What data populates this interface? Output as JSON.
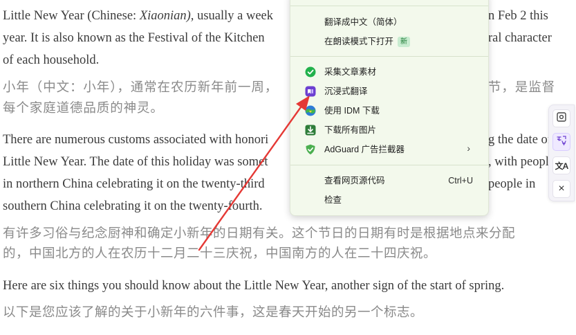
{
  "article": {
    "p1": [
      "Little New Year (Chinese: ",
      "Xiaonian),",
      " usually a week",
      "n Feb 2 this",
      "year. It is also known as the Festival of the Kitchen",
      "ral character",
      "of each household."
    ],
    "zh1": [
      "小年（中文：小年），通常在农历新年前一周，",
      "节，是监督",
      "每个家庭道德品质的神灵。"
    ],
    "p2": [
      "There are numerous customs associated with honori",
      "g the date of",
      "Little New Year. The date of this holiday was somet",
      ", with peopl",
      "in northern China celebrating it on the twenty-third",
      "people in",
      "southern China celebrating it on the twenty-fourth."
    ],
    "zh2": [
      "有许多习俗与纪念厨神和确定小新年的日期有关。这个节日的日期有时是根据地点来分配",
      "的，中国北方的人在农历十二月二十三庆祝，中国南方的人在二十四庆祝。"
    ],
    "p3": "Here are six things you should know about the Little New Year, another sign of the start of spring.",
    "zh3": "以下是您应该了解的关于小新年的六件事，这是春天开始的另一个标志。"
  },
  "context_menu": {
    "translate": "翻译成中文（简体）",
    "reader_mode": "在朗读模式下打开",
    "reader_badge": "新",
    "collect": "采集文章素材",
    "immersive": "沉浸式翻译",
    "idm": "使用 IDM 下载",
    "download_images": "下载所有图片",
    "adguard": "AdGuard 广告拦截器",
    "adguard_arrow": "›",
    "view_source": "查看网页源代码",
    "view_source_shortcut": "Ctrl+U",
    "inspect": "检查"
  },
  "side_toolbar": {
    "translate_glyph": "文A",
    "close_glyph": "×"
  },
  "colors": {
    "menu_bg": "#f3f9ec",
    "annotation_arrow": "#e53935",
    "immersive_purple": "#6c3fd1",
    "collect_green": "#22b14c",
    "adguard_green": "#4caf50"
  },
  "icons": [
    "collect-icon",
    "immersive-translate-icon",
    "idm-icon",
    "download-icon",
    "adguard-shield-icon",
    "screenshot-icon",
    "translate-page-icon",
    "translate-icon",
    "close-icon"
  ]
}
